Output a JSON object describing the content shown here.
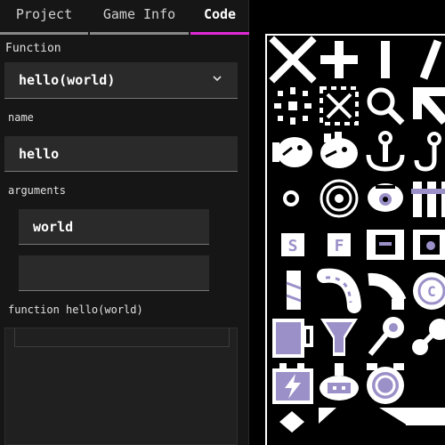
{
  "tabs": [
    {
      "label": "Project",
      "active": false
    },
    {
      "label": "Game Info",
      "active": false
    },
    {
      "label": "Code",
      "active": true
    }
  ],
  "function_section": {
    "label": "Function",
    "selected": "hello(world)",
    "dropdown_icon": "chevron-down-icon"
  },
  "name_section": {
    "label": "name",
    "value": "hello"
  },
  "arguments_section": {
    "label": "arguments",
    "values": [
      "world",
      ""
    ]
  },
  "code_section": {
    "header": "function hello(world)",
    "body": ""
  },
  "sprite_sheet": {
    "colors": {
      "primary": "#ffffff",
      "accent": "#9b90c8",
      "background": "#000000"
    },
    "sprites": [
      "close-sprite",
      "plus-sprite",
      "bar-sprite",
      "slash-sprite",
      "burst-sprite",
      "crosshair-sprite",
      "magnifier-sprite",
      "arrow-sprite",
      "fish-sprite",
      "fish-sprite-2",
      "anchor-sprite",
      "hook-sprite",
      "dot-sprite",
      "target-sprite",
      "eye-sprite",
      "pillars-sprite",
      "tile-s-sprite",
      "tile-f-sprite",
      "scroll-sprite",
      "scroll-sprite-2",
      "segment-sprite",
      "bean-sprite",
      "tube-sprite",
      "coin-sprite",
      "mug-sprite",
      "goblet-sprite",
      "lollipop-sprite",
      "spoon-sprite",
      "battery-sprite",
      "robot-sprite",
      "alarm-clock-sprite",
      "diamond-sprite",
      "flag-sprite",
      "wedge-sprite",
      "bar-block-sprite"
    ]
  }
}
